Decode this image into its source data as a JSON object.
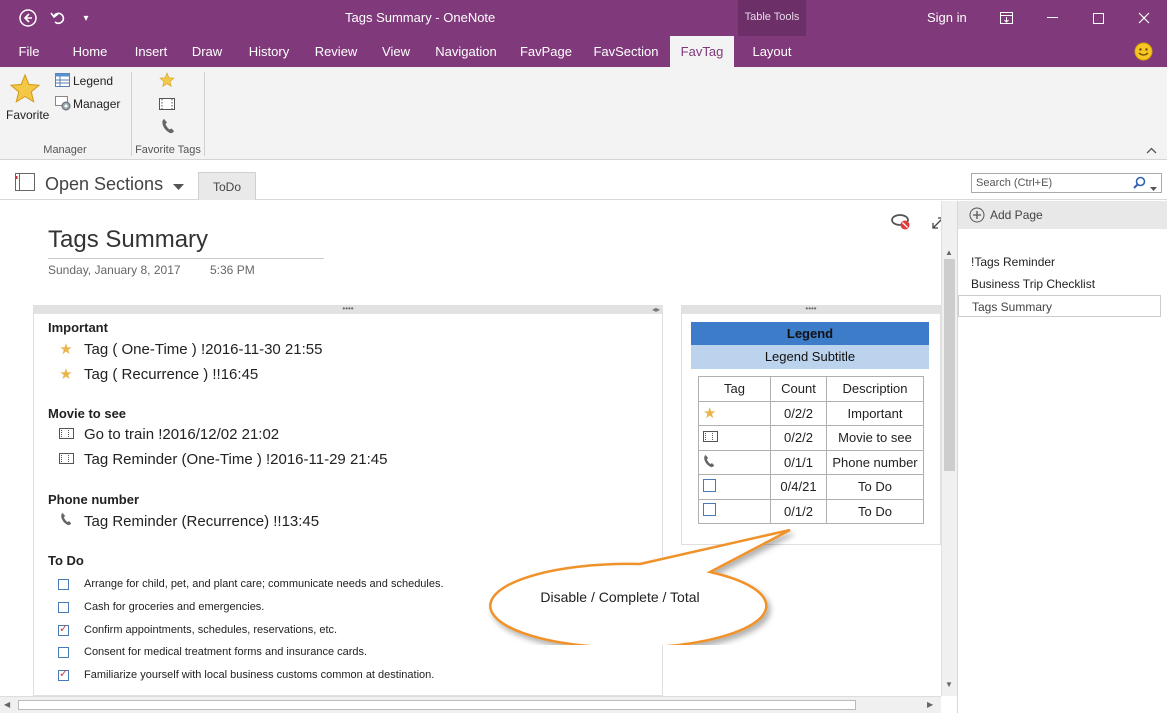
{
  "window": {
    "title": "Tags Summary  -  OneNote",
    "table_tools": "Table Tools",
    "sign_in": "Sign in"
  },
  "ribbon_tabs": [
    "File",
    "Home",
    "Insert",
    "Draw",
    "History",
    "Review",
    "View",
    "Navigation",
    "FavPage",
    "FavSection",
    "FavTag",
    "Layout"
  ],
  "active_tab": "FavTag",
  "ribbon": {
    "favorite_label": "Favorite",
    "legend_label": "Legend",
    "manager_label": "Manager",
    "group_manager": "Manager",
    "group_favorite_tags": "Favorite Tags"
  },
  "notebook": {
    "open_sections": "Open Sections",
    "section_tab": "ToDo",
    "search_placeholder": "Search (Ctrl+E)"
  },
  "page": {
    "title": "Tags Summary",
    "date": "Sunday, January 8, 2017",
    "time": "5:36 PM"
  },
  "tag_groups": {
    "important": {
      "heading": "Important",
      "items": [
        "Tag ( One-Time ) !2016-11-30 21:55",
        "Tag ( Recurrence ) !!16:45"
      ]
    },
    "movie": {
      "heading": "Movie to see",
      "items": [
        "Go to train !2016/12/02 21:02",
        "Tag Reminder (One-Time ) !2016-11-29 21:45"
      ]
    },
    "phone": {
      "heading": "Phone number",
      "items": [
        "Tag Reminder (Recurrence) !!13:45"
      ]
    },
    "todo": {
      "heading": "To Do",
      "items": [
        {
          "text": "Arrange for child, pet, and plant care; communicate needs and schedules.",
          "checked": false
        },
        {
          "text": "Cash for groceries and emergencies.",
          "checked": false
        },
        {
          "text": "Confirm appointments, schedules, reservations, etc.",
          "checked": true
        },
        {
          "text": "Consent for medical treatment forms and insurance cards.",
          "checked": false
        },
        {
          "text": "Familiarize yourself with local business customs common at destination.",
          "checked": true
        }
      ]
    }
  },
  "legend": {
    "title": "Legend",
    "subtitle": "Legend Subtitle",
    "headers": [
      "Tag",
      "Count",
      "Description"
    ],
    "rows": [
      {
        "icon": "star-icon",
        "count": "0/2/2",
        "description": "Important"
      },
      {
        "icon": "film-icon",
        "count": "0/2/2",
        "description": "Movie to see"
      },
      {
        "icon": "phone-icon",
        "count": "0/1/1",
        "description": "Phone number"
      },
      {
        "icon": "checkbox-icon",
        "count": "0/4/21",
        "description": "To Do"
      },
      {
        "icon": "checkbox-icon",
        "count": "0/1/2",
        "description": "To Do"
      }
    ]
  },
  "callout": "Disable / Complete / Total",
  "page_list": {
    "add_page": "Add Page",
    "pages": [
      "!Tags Reminder",
      "Business Trip Checklist",
      "Tags Summary"
    ],
    "selected": "Tags Summary"
  },
  "colors": {
    "accent": "#80397b",
    "legend_title_bg": "#3d7cc9",
    "legend_subtitle_bg": "#bcd3ee",
    "callout_border": "#f0922b"
  }
}
